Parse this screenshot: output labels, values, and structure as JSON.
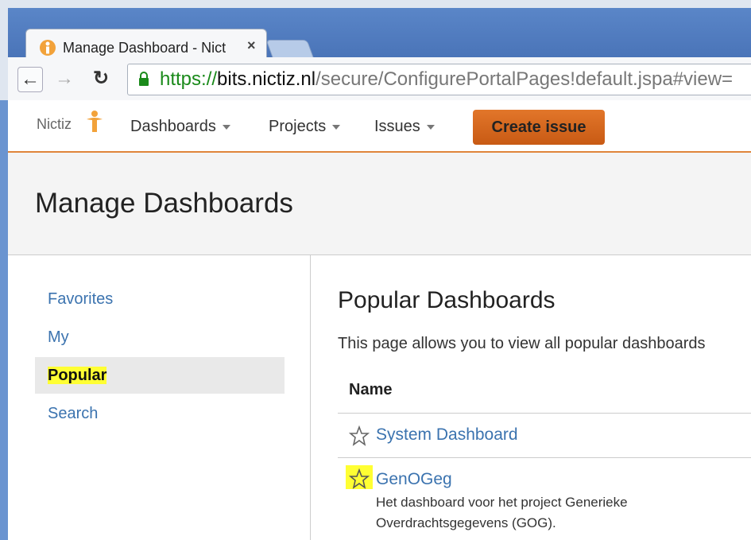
{
  "browser": {
    "tab_title": "Manage Dashboard - Nict",
    "close_glyph": "×",
    "url": {
      "scheme": "https://",
      "host": "bits.nictiz.nl",
      "path": "/secure/ConfigurePortalPages!default.jspa#view="
    }
  },
  "header": {
    "logo_text": "Nictiz",
    "menus": [
      "Dashboards",
      "Projects",
      "Issues"
    ],
    "create_label": "Create issue",
    "accent": "#e0853a"
  },
  "page": {
    "title": "Manage Dashboards"
  },
  "sidebar": {
    "items": [
      {
        "label": "Favorites",
        "active": false
      },
      {
        "label": "My",
        "active": false
      },
      {
        "label": "Popular",
        "active": true
      },
      {
        "label": "Search",
        "active": false
      }
    ]
  },
  "main": {
    "title": "Popular Dashboards",
    "description": "This page allows you to view all popular dashboards",
    "column_name": "Name",
    "dashboards": [
      {
        "name": "System Dashboard",
        "description": ""
      },
      {
        "name": "GenOGeg",
        "description_lines": [
          "Het dashboard voor het project Generieke",
          "Overdrachtsgegevens (GOG)."
        ]
      }
    ]
  },
  "colors": {
    "link": "#3b73af",
    "highlight": "#ffff33"
  }
}
